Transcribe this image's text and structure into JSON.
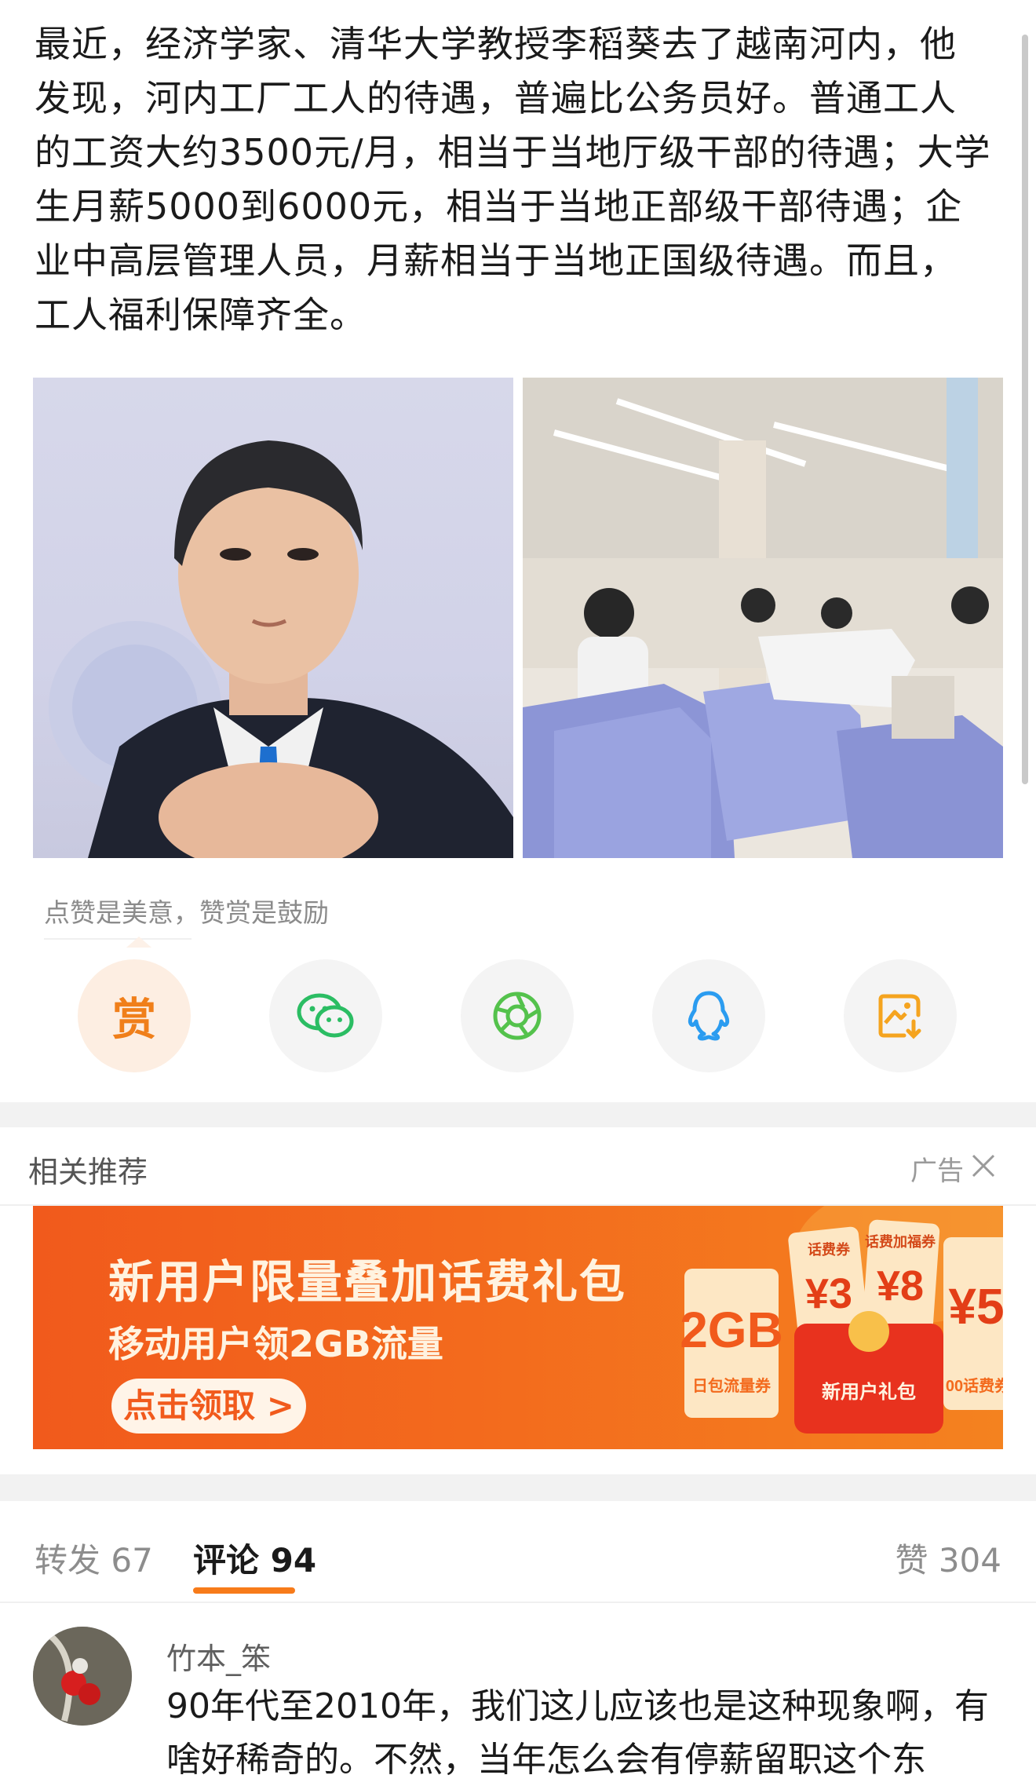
{
  "post": {
    "text": "最近，经济学家、清华大学教授李稻葵去了越南河内，他发现，河内工厂工人的待遇，普遍比公务员好。普通工人的工资大约3500元/月，相当于当地厅级干部的待遇；大学生月薪5000到6000元，相当于当地正部级干部待遇；企业中高层管理人员，月薪相当于当地正国级待遇。而且，工人福利保障齐全。"
  },
  "reward": {
    "tip": "点赞是美意，赞赏是鼓励",
    "reward_glyph": "赏"
  },
  "share": {
    "icons": [
      "reward-icon",
      "wechat-icon",
      "moments-icon",
      "qq-icon",
      "save-image-icon"
    ]
  },
  "recommend": {
    "title": "相关推荐",
    "ad_label": "广告"
  },
  "banner": {
    "headline": "新用户限量叠加话费礼包",
    "subline": "移动用户领2GB流量",
    "button": "点击领取 >",
    "coupon_2gb": "2GB",
    "coupon_2gb_caption": "日包流量券",
    "coupon_3": "¥3",
    "coupon_8": "¥8",
    "coupon_5": "¥5",
    "coupon_tag1": "话费券",
    "coupon_tag2": "话费加福券",
    "gift_label": "新用户礼包",
    "coupon_5_caption": "00话费券"
  },
  "tabs": {
    "repost": "转发 67",
    "comment": "评论 94",
    "like": "赞 304"
  },
  "comment": {
    "user": "竹本_笨",
    "text": "90年代至2010年，我们这儿应该也是这种现象啊，有啥好稀奇的。不然，当年怎么会有停薪留职这个东"
  },
  "colors": {
    "accent": "#f77b1a",
    "banner": "#f15a1c",
    "wechat": "#2bbd63",
    "moments": "#54c24c",
    "qq": "#2b9cf0",
    "save": "#f5a41f"
  }
}
